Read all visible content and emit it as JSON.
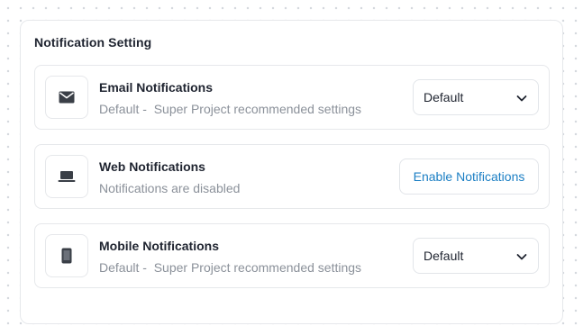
{
  "panel": {
    "title": "Notification Setting"
  },
  "rows": [
    {
      "title": "Email Notifications",
      "subtitle": "Default -  Super Project recommended settings",
      "icon": "envelope-icon",
      "control": {
        "type": "select",
        "value": "Default"
      }
    },
    {
      "title": "Web Notifications",
      "subtitle": "Notifications are disabled",
      "icon": "laptop-icon",
      "control": {
        "type": "button",
        "label": "Enable Notifications"
      }
    },
    {
      "title": "Mobile Notifications",
      "subtitle": "Default -  Super Project recommended settings",
      "icon": "phone-icon",
      "control": {
        "type": "select",
        "value": "Default"
      }
    }
  ],
  "colors": {
    "text_primary": "#1f2430",
    "text_secondary": "#8b919a",
    "accent": "#1c7fc4",
    "border": "#e6e8eb"
  }
}
